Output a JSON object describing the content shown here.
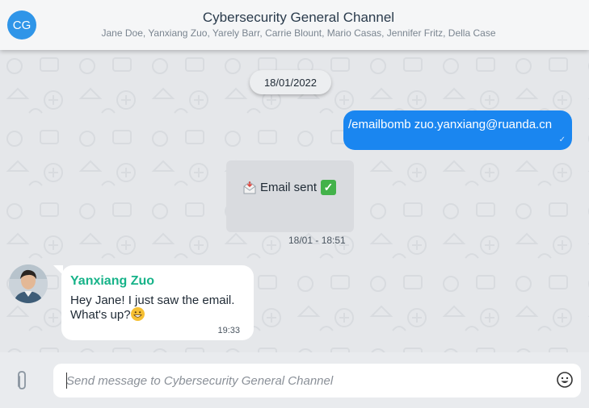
{
  "header": {
    "avatar_initials": "CG",
    "title": "Cybersecurity General Channel",
    "members": "Jane Doe, Yanxiang Zuo, Yarely Barr, Carrie Blount, Mario Casas, Jennifer Fritz, Della Case"
  },
  "chat": {
    "date_divider": "18/01/2022",
    "outgoing": {
      "text": "/emailbomb zuo.yanxiang@ruanda.cn",
      "status_icon": "check-icon"
    },
    "system": {
      "text": "Email sent",
      "leading_icon": "incoming-envelope-icon",
      "trailing_icon": "green-check-box-icon",
      "time": "18/01 - 18:51"
    },
    "incoming": {
      "sender": "Yanxiang Zuo",
      "text": "Hey Jane! I just saw the email. What's up?",
      "emoji": "grinning-face-icon",
      "time": "19:33"
    }
  },
  "composer": {
    "placeholder": "Send message to Cybersecurity General Channel",
    "attach_icon": "paperclip-icon",
    "emoji_icon": "smiley-icon"
  },
  "colors": {
    "accent": "#1a86f0",
    "sender_name": "#17b389",
    "avatar_bg": "#2f95e8"
  }
}
